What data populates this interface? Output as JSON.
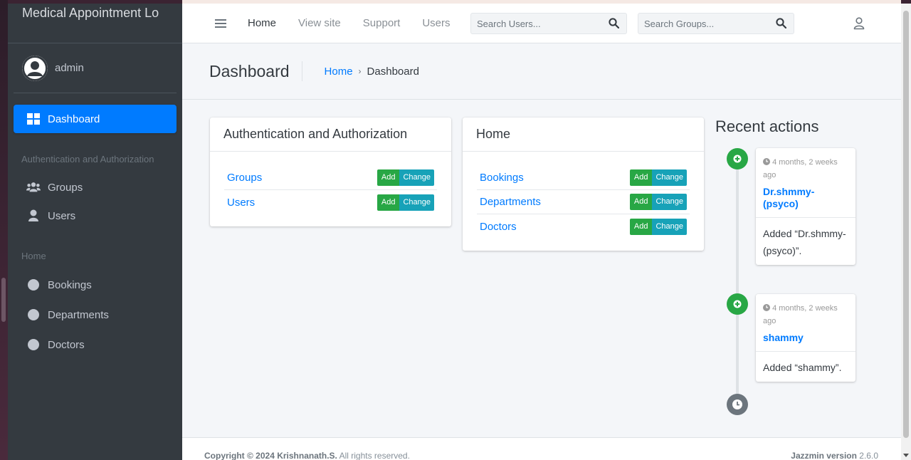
{
  "brand": {
    "title": "Medical Appointment Lo"
  },
  "user": {
    "name": "admin"
  },
  "sidebar": {
    "dashboard": "Dashboard",
    "section_auth": "Authentication and Authorization",
    "auth_items": [
      {
        "label": "Groups",
        "icon": "users-icon"
      },
      {
        "label": "Users",
        "icon": "user-icon"
      }
    ],
    "section_home": "Home",
    "home_items": [
      {
        "label": "Bookings",
        "icon": "circle-icon"
      },
      {
        "label": "Departments",
        "icon": "circle-icon"
      },
      {
        "label": "Doctors",
        "icon": "circle-icon"
      }
    ]
  },
  "topbar": {
    "links": [
      "Home",
      "View site",
      "Support",
      "Users"
    ],
    "search_users_placeholder": "Search Users...",
    "search_groups_placeholder": "Search Groups..."
  },
  "header": {
    "title": "Dashboard",
    "breadcrumb_home": "Home",
    "breadcrumb_current": "Dashboard"
  },
  "apps": [
    {
      "title": "Authentication and Authorization",
      "models": [
        {
          "name": "Groups",
          "add": "Add",
          "change": "Change"
        },
        {
          "name": "Users",
          "add": "Add",
          "change": "Change"
        }
      ]
    },
    {
      "title": "Home",
      "models": [
        {
          "name": "Bookings",
          "add": "Add",
          "change": "Change"
        },
        {
          "name": "Departments",
          "add": "Add",
          "change": "Change"
        },
        {
          "name": "Doctors",
          "add": "Add",
          "change": "Change"
        }
      ]
    }
  ],
  "recent": {
    "title": "Recent actions",
    "items": [
      {
        "time": "4 months, 2 weeks ago",
        "object": "Dr.shmmy-(psyco)",
        "action": "Added “Dr.shmmy-(psyco)”."
      },
      {
        "time": "4 months, 2 weeks ago",
        "object": "shammy",
        "action": "Added “shammy”."
      }
    ]
  },
  "footer": {
    "copyright_prefix": "Copyright © 2024 Krishnanath.S.",
    "copyright_suffix": " All rights reserved.",
    "version_label": "Jazzmin version",
    "version": " 2.6.0"
  },
  "colors": {
    "sidebar_bg": "#343a40",
    "accent": "#007bff",
    "add_button": "#28a745",
    "change_button": "#17a2b8"
  }
}
